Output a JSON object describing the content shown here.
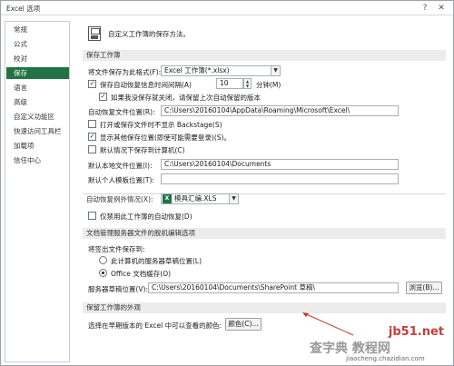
{
  "window": {
    "title": "Excel 选项",
    "min": "?",
    "close": "✕"
  },
  "sidebar": {
    "items": [
      {
        "label": "常规"
      },
      {
        "label": "公式"
      },
      {
        "label": "校对"
      },
      {
        "label": "保存",
        "active": true
      },
      {
        "label": "语言"
      },
      {
        "label": "高级"
      },
      {
        "label": "自定义功能区"
      },
      {
        "label": "快速访问工具栏"
      },
      {
        "label": "加载项"
      },
      {
        "label": "信任中心"
      }
    ]
  },
  "header": {
    "title": "自定义工作簿的保存方法。"
  },
  "save_workbooks": {
    "section": "保存工作簿",
    "format_label": "将文件保存为此格式(F):",
    "format_value": "Excel 工作簿(*.xlsx)",
    "autorecover_label": "保存自动恢复信息时间间隔(A)",
    "autorecover_minutes": "10",
    "minutes_unit": "分钟(M)",
    "keep_last_label": "如果我没保存就关闭，请保留上次自动保留的版本",
    "autorecover_loc_label": "自动恢复文件位置(R):",
    "autorecover_loc_value": "C:\\Users\\20160104\\AppData\\Roaming\\Microsoft\\Excel\\",
    "no_backstage_label": "打开或保存文件时不显示 Backstage(S)",
    "show_other_label": "显示其他保存位置(即使可能需要登录)(S)。",
    "default_computer_label": "默认情况下保存到计算机(C)",
    "local_loc_label": "默认本地文件位置(I):",
    "local_loc_value": "C:\\Users\\20160104\\Documents",
    "personal_tmpl_label": "默认个人模板位置(T):",
    "personal_tmpl_value": ""
  },
  "autorecover_exceptions": {
    "label": "自动恢复例外情况(X):",
    "workbook": "模具汇编.XLS",
    "disable_label": "仅禁用此工作簿的自动恢复(D)"
  },
  "offline": {
    "section": "文档管理服务器文件的脱机编辑选项",
    "save_to_label": "将签出文件保存到:",
    "opt_server": "此计算机的服务器草稿位置(L)",
    "opt_cache": "Office 文档缓存(O)",
    "drafts_label": "服务器草稿位置(V):",
    "drafts_value": "C:\\Users\\20160104\\Documents\\SharePoint 草稿\\",
    "browse": "浏览(B)..."
  },
  "visual": {
    "section": "保留工作簿的外观",
    "colors_label": "选择在早期版本的 Excel 中可以查看的颜色:",
    "colors_button": "颜色(C)..."
  },
  "watermark": {
    "site": "jb51.net",
    "brand": "查字典 教程网",
    "url": "jiaocheng.chazidian.com"
  },
  "colors": {
    "accent": "#217346",
    "section_bg": "#ececec"
  }
}
